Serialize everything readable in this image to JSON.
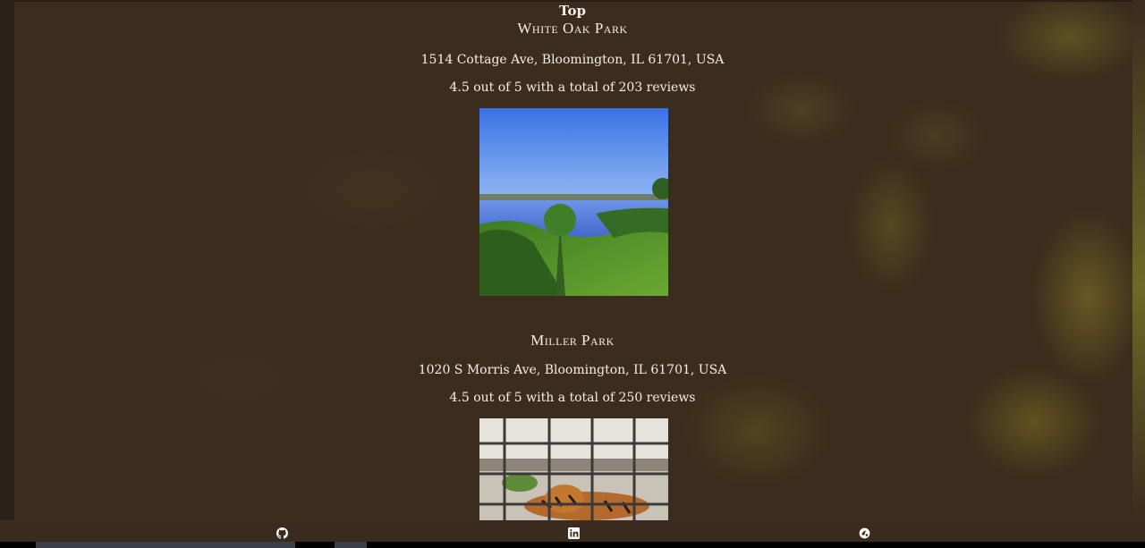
{
  "nav": {
    "top_label": "Top"
  },
  "parks": [
    {
      "name": "White Oak Park",
      "address": "1514 Cottage Ave, Bloomington, IL 61701, USA",
      "rating_text": "4.5 out of 5 with a total of 203 reviews"
    },
    {
      "name": "Miller Park",
      "address": "1020 S Morris Ave, Bloomington, IL 61701, USA",
      "rating_text": "4.5 out of 5 with a total of 250 reviews"
    }
  ],
  "footer": {
    "icons": [
      "github-icon",
      "linkedin-icon",
      "website-icon"
    ]
  },
  "colors": {
    "background": "#3b2c1d",
    "text": "#f4efe6",
    "footer": "#3b2a1e"
  }
}
